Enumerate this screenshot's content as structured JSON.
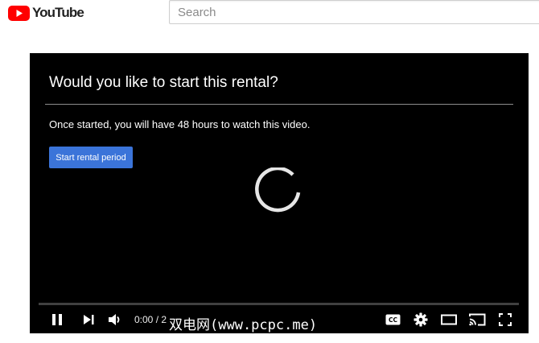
{
  "header": {
    "logo_text": "YouTube",
    "brand_color": "#ff0000",
    "search": {
      "placeholder": "Search",
      "value": ""
    }
  },
  "rental_dialog": {
    "title": "Would you like to start this rental?",
    "description": "Once started, you will have 48 hours to watch this video.",
    "start_button_label": "Start rental period",
    "button_color": "#3b74d9"
  },
  "player": {
    "loading": true,
    "time_display": "0:00 / 2",
    "controls": {
      "play_pause": "pause-icon",
      "next": "skip-next-icon",
      "volume": "volume-icon",
      "captions": "closed-captions-icon",
      "settings": "gear-icon",
      "theater": "theater-mode-icon",
      "cast": "cast-icon",
      "fullscreen": "fullscreen-icon"
    }
  },
  "watermark": {
    "text": "双电网(www.pcpc.me)"
  }
}
